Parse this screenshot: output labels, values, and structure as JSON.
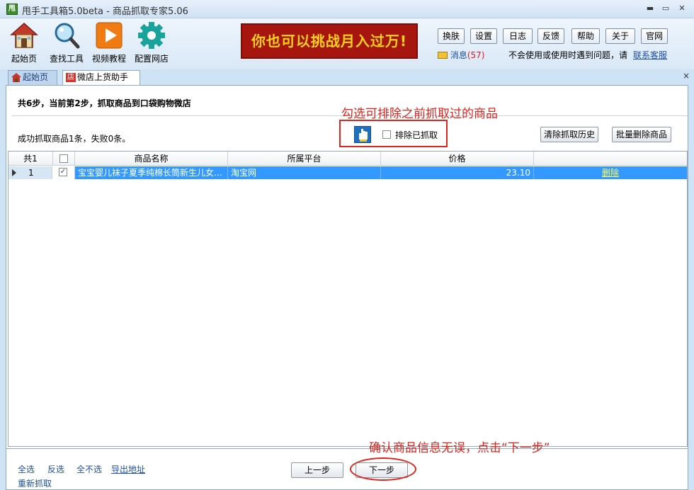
{
  "window": {
    "title": "甩手工具箱5.0beta - 商品抓取专家5.06",
    "app_icon_text": "甩",
    "minimize": "▬",
    "maximize": "▭",
    "close": "✕"
  },
  "toolbar": {
    "items": [
      {
        "label": "起始页",
        "icon": "house-icon"
      },
      {
        "label": "查找工具",
        "icon": "magnifier-icon"
      },
      {
        "label": "视频教程",
        "icon": "play-icon"
      },
      {
        "label": "配置网店",
        "icon": "gear-icon"
      }
    ]
  },
  "banner": {
    "text": "你也可以挑战月入过万!"
  },
  "top_buttons": [
    "换肤",
    "设置",
    "日志",
    "反馈",
    "帮助",
    "关于",
    "官网"
  ],
  "messages": {
    "label": "消息",
    "count": "(57)"
  },
  "help": {
    "text": "不会使用或使用时遇到问题，请",
    "link": "联系客服"
  },
  "tabs": [
    {
      "label": "起始页",
      "icon": "house-icon"
    },
    {
      "label": "微店上货助手",
      "icon": "shop-icon",
      "icon_text": "店"
    }
  ],
  "tab_close": "×",
  "panel": {
    "step_text": "共6步，当前第2步，抓取商品到口袋购物微店",
    "result_text": "成功抓取商品1条，失败0条。",
    "exclude_label": "排除已抓取",
    "clear_history": "清除抓取历史",
    "batch_delete": "批量删除商品",
    "annotation_top": "勾选可排除之前抓取过的商品",
    "annotation_bottom": "确认商品信息无误，点击“下一步”"
  },
  "grid": {
    "headers": {
      "count": "共1",
      "name": "商品名称",
      "platform": "所属平台",
      "price": "价格"
    },
    "rows": [
      {
        "index": "1",
        "checked": true,
        "name": "宝宝婴儿袜子夏季纯棉长筒新生儿女…",
        "platform": "淘宝网",
        "price": "23.10",
        "action": "删除"
      }
    ]
  },
  "footer": {
    "select_all": "全选",
    "invert": "反选",
    "select_none": "全不选",
    "export": "导出地址",
    "regrab": "重新抓取",
    "prev": "上一步",
    "next": "下一步"
  },
  "colors": {
    "accent": "#3399ff",
    "annotation": "#e0241c",
    "banner_bg": "#a6150e",
    "banner_text": "#ffd21a",
    "link": "#1e4fa8"
  }
}
